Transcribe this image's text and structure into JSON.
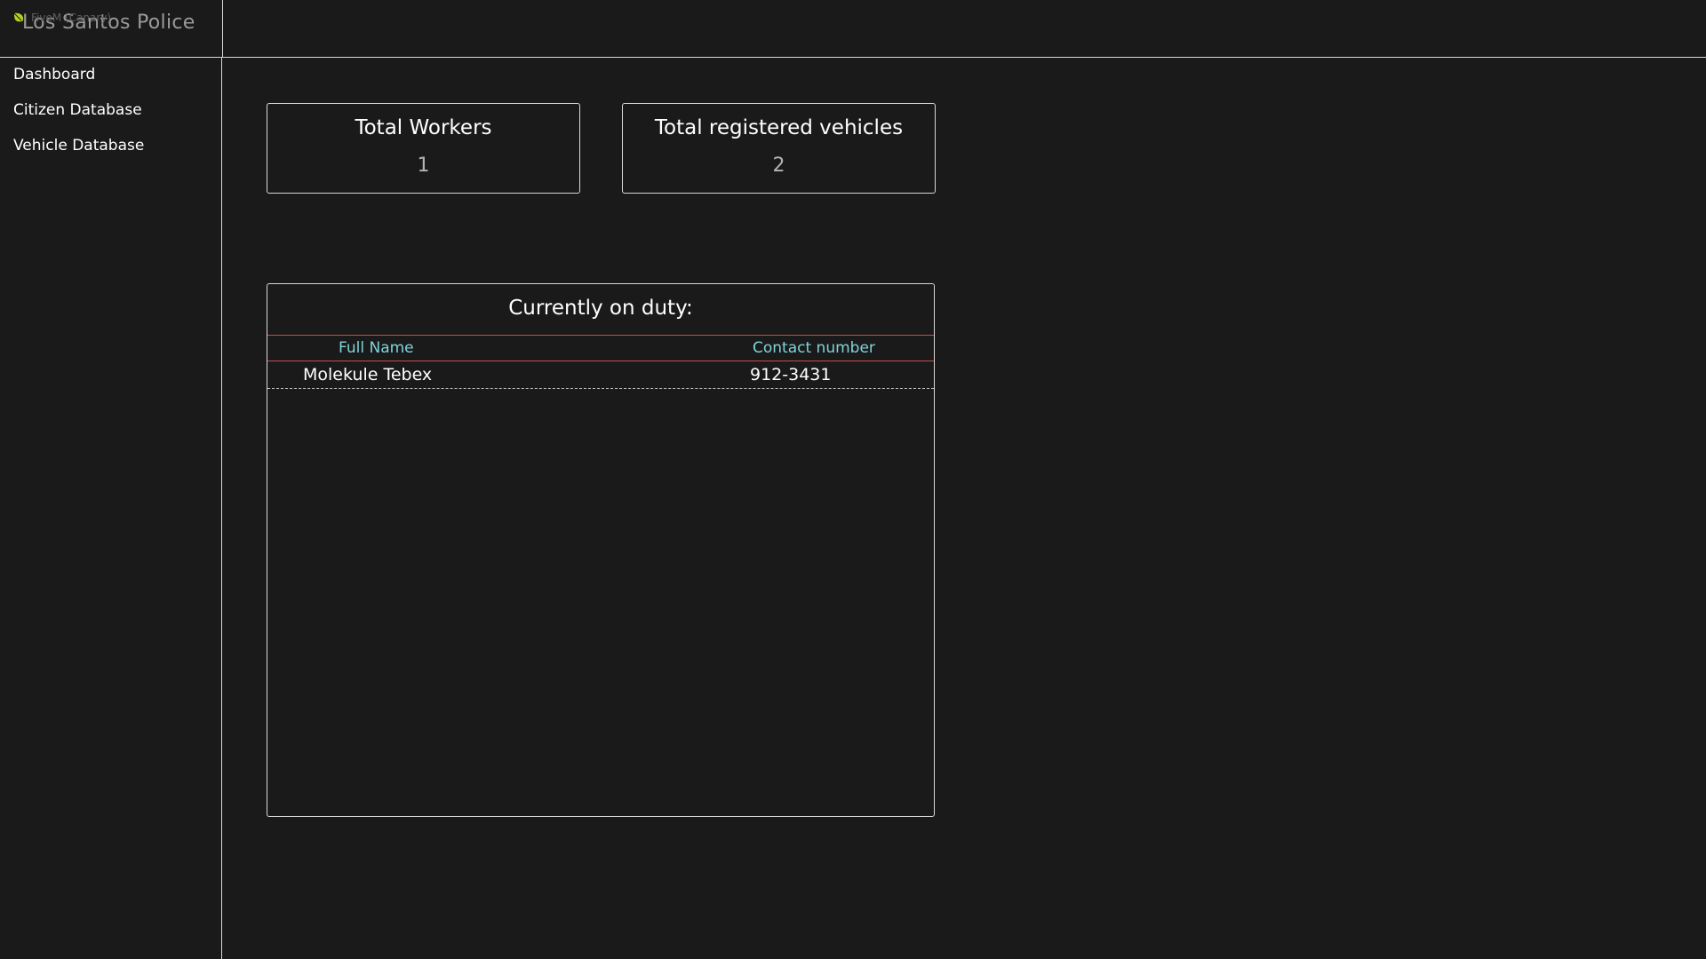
{
  "app": {
    "title": "Los Santos Police",
    "overlay_label": "FiveM (Canary)"
  },
  "sidebar": {
    "items": [
      {
        "label": "Dashboard"
      },
      {
        "label": "Citizen Database"
      },
      {
        "label": "Vehicle Database"
      }
    ]
  },
  "stats": {
    "workers": {
      "title": "Total Workers",
      "value": "1"
    },
    "vehicles": {
      "title": "Total registered vehicles",
      "value": "2"
    }
  },
  "on_duty": {
    "title": "Currently on duty:",
    "columns": [
      "Full Name",
      "Contact number"
    ],
    "rows": [
      {
        "full_name": "Molekule Tebex",
        "contact": "912-3431"
      }
    ]
  },
  "colors": {
    "background": "#1a1a1a",
    "border": "#d8d8d8",
    "header_text": "#7fd3d9",
    "header_rule": "#c0504d",
    "leaf_icon": "#b5d21e"
  },
  "icons": {
    "overlay": "leaf-icon"
  }
}
